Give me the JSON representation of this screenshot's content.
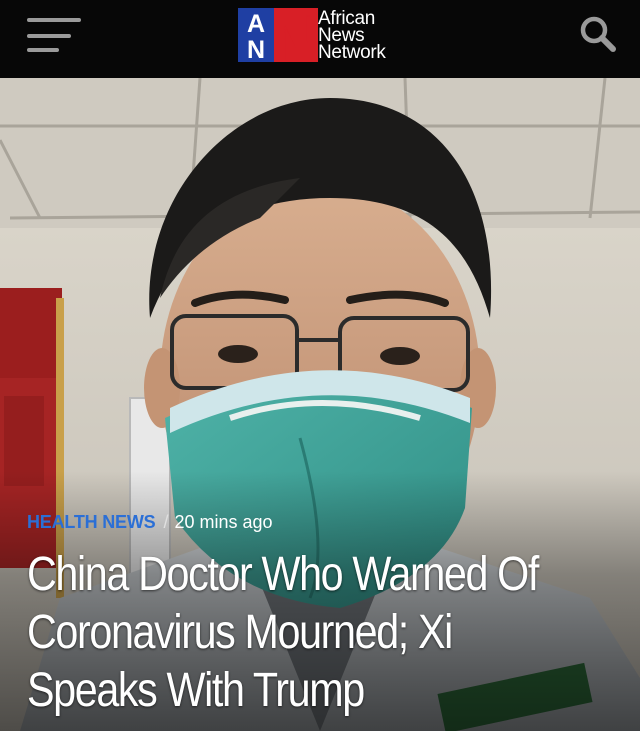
{
  "header": {
    "menu_icon": "hamburger-menu-icon",
    "search_icon": "search-icon",
    "logo": {
      "mark_letters": [
        "A",
        "N",
        "N"
      ],
      "text_lines": [
        "African",
        "News",
        "Network"
      ],
      "colors": {
        "blue": "#1f3fa3",
        "red": "#d81f26",
        "white": "#ffffff"
      }
    }
  },
  "article": {
    "category": "HEALTH NEWS",
    "separator": "/",
    "time_ago": "20 mins ago",
    "headline_lines": [
      "China Doctor Who Warned Of",
      "Coronavirus Mourned; Xi",
      "Speaks With Trump"
    ],
    "category_color": "#2b6fd6"
  }
}
